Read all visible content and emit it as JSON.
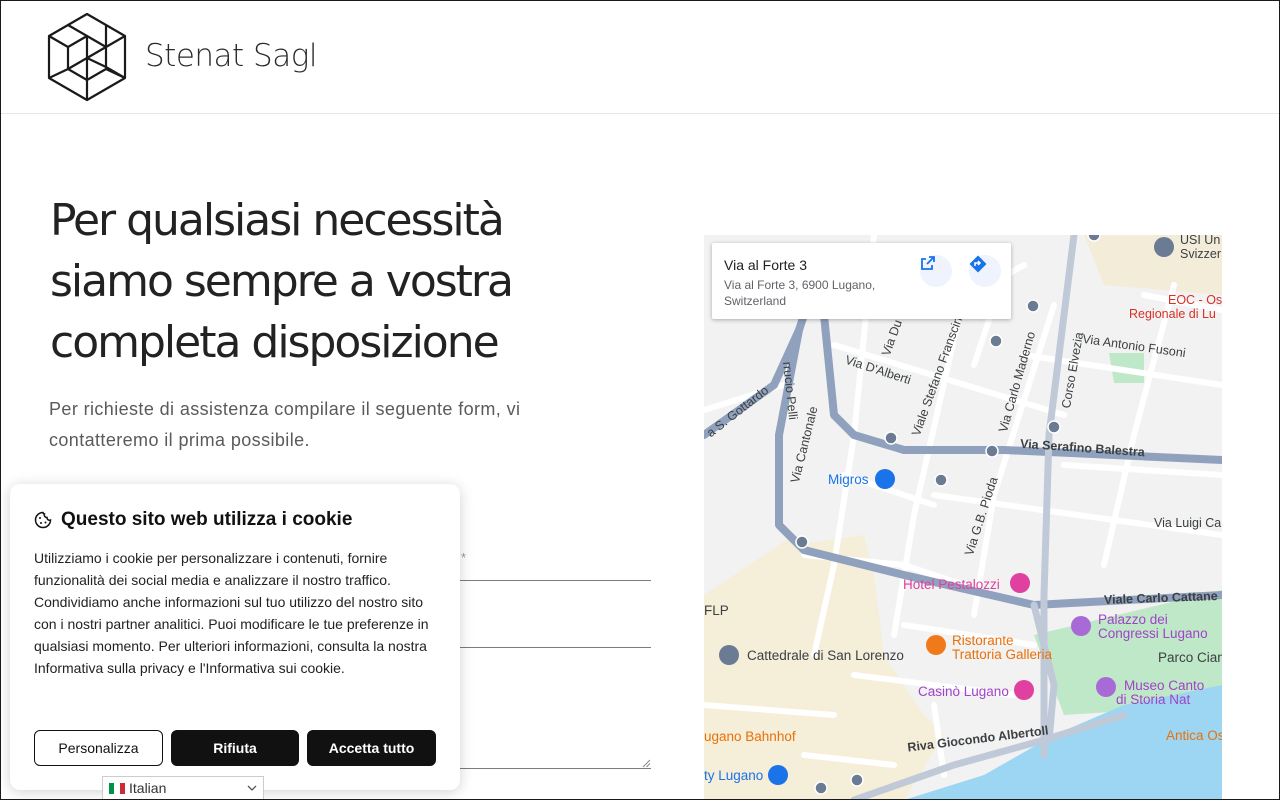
{
  "header": {
    "brand": "Stenat Sagl"
  },
  "hero": {
    "headline_lines": [
      "Per qualsiasi necessità",
      "siamo sempre a vostra",
      "completa disposizione"
    ],
    "subtext": "Per richieste di assistenza compilare il seguente form, vi contatteremo il prima possibile."
  },
  "form": {
    "required_marker": "*"
  },
  "map": {
    "card": {
      "title": "Via al Forte 3",
      "address": "Via al Forte 3, 6900 Lugano, Switzerland"
    },
    "labels": {
      "usi": "USI Un",
      "usi2": "Svizzer",
      "eoc": "EOC - Os",
      "eoc2": "Regionale di Lu",
      "fusoni": "Via Antonio Fusoni",
      "durrucio": "rrucio Pelli",
      "dalberti": "Via D'Alberti",
      "du": "Via Du",
      "francini": "Viale Stefano Franscini",
      "mademo": "Via Carlo Maderno",
      "elvezia": "Corso Elvezia",
      "gottardo": "a S. Gottardo",
      "cantonale": "Via Cantonale",
      "balestra": "Via Serafino Balestra",
      "migros": "Migros",
      "cai": "Via Luigi Ca",
      "pioda": "Via G.B. Pioda",
      "pestalozzi": "Hotel Pestalozzi",
      "cattaneo": "Viale Carlo Cattane",
      "flp": "FLP",
      "palazzo": "Palazzo dei",
      "palazzo2": "Congressi Lugano",
      "parco": "Parco Ciani",
      "ristorante": "Ristorante",
      "ristorante2": "Trattoria Galleria",
      "cattedrale": "Cattedrale di San Lorenzo",
      "casino": "Casinò Lugano",
      "museo": "Museo Canto",
      "museo2": "di Storia Nat",
      "bahnhof": "ugano Bahnhof",
      "riva": "Riva Giocondo Albertoll",
      "antica": "Antica Os",
      "tylugano": "ty Lugano"
    }
  },
  "cookie": {
    "title": "Questo sito web utilizza i cookie",
    "text": "Utilizziamo i cookie per personalizzare i contenuti, fornire funzionalità dei social media e analizzare il nostro traffico. Condividiamo anche informazioni sul tuo utilizzo del nostro sito con i nostri partner analitici. Puoi modificare le tue preferenze in qualsiasi momento. Per ulteriori informazioni, consulta la nostra Informativa sulla privacy e l'Informativa sui cookie.",
    "customize": "Personalizza",
    "reject": "Rifiuta",
    "accept": "Accetta tutto"
  },
  "language": {
    "selected": "Italian"
  },
  "colors": {
    "accent_dark": "#111111",
    "map_road": "#8fa1bd",
    "map_water": "#9cd6f2",
    "map_park": "#bfe8c9",
    "map_link": "#1a73e8"
  }
}
